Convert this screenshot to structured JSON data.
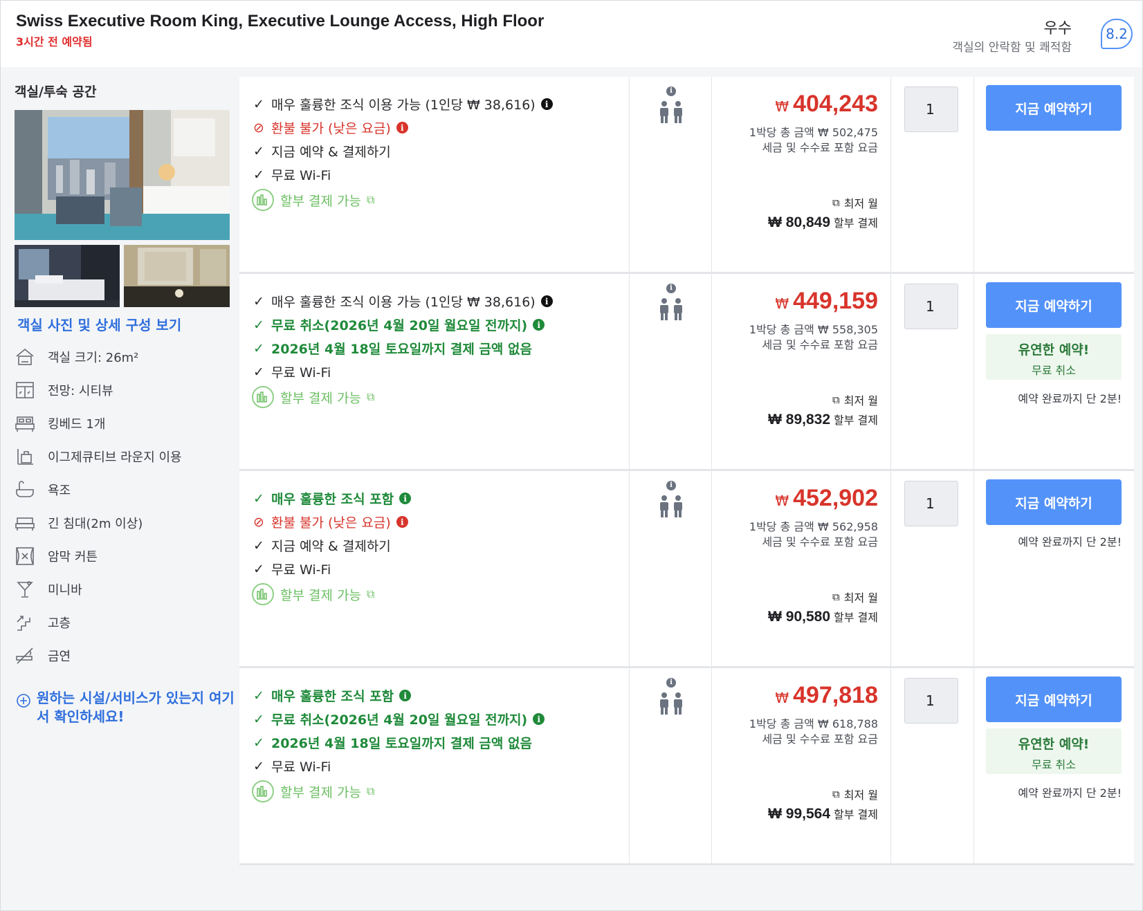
{
  "header": {
    "title": "Swiss Executive Room King, Executive Lounge Access, High Floor",
    "booked_note": "3시간 전 예약됨",
    "rating_word": "우수",
    "rating_sub": "객실의 안락함 및 쾌적함",
    "rating_score": "8.2"
  },
  "left": {
    "title": "객실/투숙 공간",
    "photo_link": "객실 사진 및 상세 구성 보기",
    "features": [
      {
        "icon": "room-size-icon",
        "label": "객실 크기: 26m²"
      },
      {
        "icon": "window-view-icon",
        "label": "전망: 시티뷰"
      },
      {
        "icon": "bed-icon",
        "label": "킹베드 1개"
      },
      {
        "icon": "lounge-icon",
        "label": "이그제큐티브 라운지 이용"
      },
      {
        "icon": "bathtub-icon",
        "label": "욕조"
      },
      {
        "icon": "long-bed-icon",
        "label": "긴 침대(2m 이상)"
      },
      {
        "icon": "blackout-curtain-icon",
        "label": "암막 커튼"
      },
      {
        "icon": "minibar-icon",
        "label": "미니바"
      },
      {
        "icon": "high-floor-icon",
        "label": "고층"
      },
      {
        "icon": "no-smoking-icon",
        "label": "금연"
      }
    ],
    "more_link": "원하는 시설/서비스가 있는지 여기서 확인하세요!"
  },
  "common": {
    "book_label": "지금 예약하기",
    "installment_label": "할부 결제 가능",
    "tax_note": "세금 및 수수료 포함 요금",
    "lowest_label": "최저 월",
    "monthly_suffix": "할부 결제",
    "currency": "₩",
    "flex_title": "유연한 예약!",
    "flex_sub": "무료 취소",
    "quick_note": "예약 완료까지 단 2분!",
    "quantity": "1"
  },
  "rates": [
    {
      "benefits": [
        {
          "style": "plain",
          "mark": "check",
          "text": "매우 훌륭한 조식 이용 가능 (1인당 ₩ 38,616)",
          "info": "dark"
        },
        {
          "style": "red",
          "mark": "no",
          "text": "환불 불가 (낮은 요금)",
          "info": "red"
        },
        {
          "style": "plain",
          "mark": "check",
          "text": "지금 예약 & 결제하기",
          "info": ""
        },
        {
          "style": "plain",
          "mark": "check",
          "text": "무료 Wi-Fi",
          "info": ""
        }
      ],
      "price": "404,243",
      "per_night": "1박당 총 금액 ₩ 502,475",
      "monthly": "₩ 80,849",
      "flexible": false,
      "quick": false
    },
    {
      "benefits": [
        {
          "style": "plain",
          "mark": "check",
          "text": "매우 훌륭한 조식 이용 가능 (1인당 ₩ 38,616)",
          "info": "dark"
        },
        {
          "style": "green",
          "mark": "check",
          "text": "무료 취소(2026년 4월 20일 월요일 전까지)",
          "info": "green"
        },
        {
          "style": "green",
          "mark": "check",
          "text": "2026년 4월 18일 토요일까지 결제 금액 없음",
          "info": ""
        },
        {
          "style": "plain",
          "mark": "check",
          "text": "무료 Wi-Fi",
          "info": ""
        }
      ],
      "price": "449,159",
      "per_night": "1박당 총 금액 ₩ 558,305",
      "monthly": "₩ 89,832",
      "flexible": true,
      "quick": true
    },
    {
      "benefits": [
        {
          "style": "green",
          "mark": "check",
          "text": "매우 훌륭한 조식 포함",
          "info": "green"
        },
        {
          "style": "red",
          "mark": "no",
          "text": "환불 불가 (낮은 요금)",
          "info": "red"
        },
        {
          "style": "plain",
          "mark": "check",
          "text": "지금 예약 & 결제하기",
          "info": ""
        },
        {
          "style": "plain",
          "mark": "check",
          "text": "무료 Wi-Fi",
          "info": ""
        }
      ],
      "price": "452,902",
      "per_night": "1박당 총 금액 ₩ 562,958",
      "monthly": "₩ 90,580",
      "flexible": false,
      "quick": true
    },
    {
      "benefits": [
        {
          "style": "green",
          "mark": "check",
          "text": "매우 훌륭한 조식 포함",
          "info": "green"
        },
        {
          "style": "green",
          "mark": "check",
          "text": "무료 취소(2026년 4월 20일 월요일 전까지)",
          "info": "green"
        },
        {
          "style": "green",
          "mark": "check",
          "text": "2026년 4월 18일 토요일까지 결제 금액 없음",
          "info": ""
        },
        {
          "style": "plain",
          "mark": "check",
          "text": "무료 Wi-Fi",
          "info": ""
        }
      ],
      "price": "497,818",
      "per_night": "1박당 총 금액 ₩ 618,788",
      "monthly": "₩ 99,564",
      "flexible": true,
      "quick": true
    }
  ]
}
